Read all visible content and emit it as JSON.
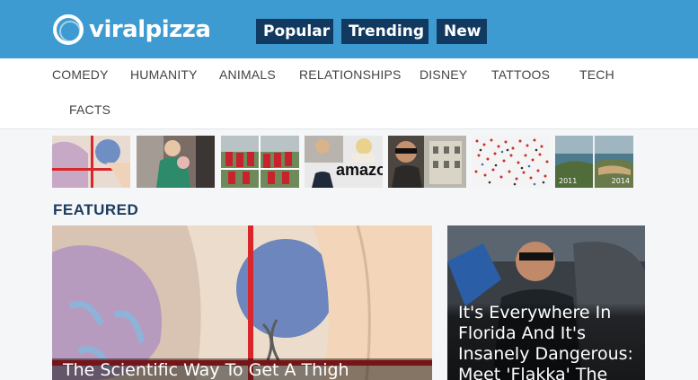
{
  "header": {
    "logo_text": "viralpizza",
    "nav": [
      "Popular",
      "Trending",
      "New"
    ],
    "colors": {
      "header_bg": "#3d9bd1",
      "nav_button_bg": "#123a60"
    }
  },
  "categories": [
    "COMEDY",
    "HUMANITY",
    "ANIMALS",
    "RELATIONSHIPS",
    "DISNEY",
    "TATTOOS",
    "TECH",
    "FACTS"
  ],
  "thumbnails": [
    {
      "name": "thigh-diagram-thumb"
    },
    {
      "name": "woman-with-baby-thumb"
    },
    {
      "name": "sports-team-thumb"
    },
    {
      "name": "amazon-people-thumb",
      "text": "amazo"
    },
    {
      "name": "man-sunglasses-street-thumb"
    },
    {
      "name": "colored-dots-map-thumb"
    },
    {
      "name": "coastline-comparison-thumb",
      "labels": [
        "2011",
        "2014"
      ]
    }
  ],
  "featured": {
    "heading": "FEATURED",
    "left_card": {
      "title": "The Scientific Way To Get A Thigh"
    },
    "right_card": {
      "title_lines": [
        "It's Everywhere In",
        "Florida And It's",
        "Insanely Dangerous:",
        "Meet 'Flakka' The"
      ]
    }
  }
}
